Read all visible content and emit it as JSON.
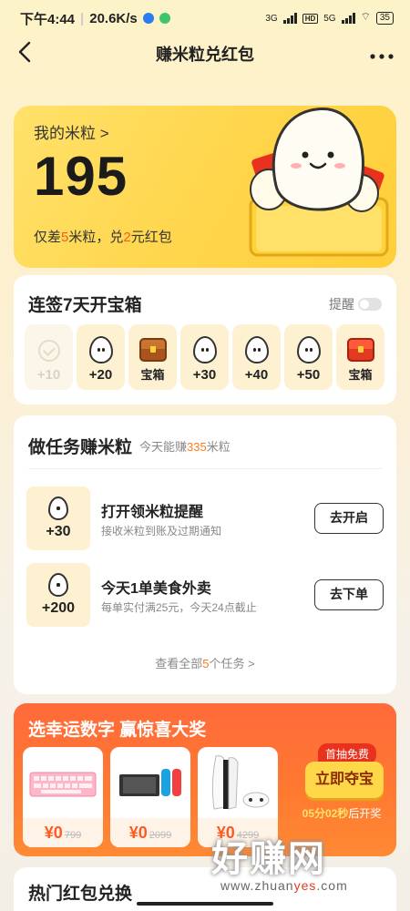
{
  "status_bar": {
    "time": "下午4:44",
    "speed": "20.6K/s",
    "net1": "3G",
    "hd": "HD",
    "net2": "5G",
    "battery": "35"
  },
  "header": {
    "title": "赚米粒兑红包",
    "back_icon": "back-arrow",
    "more_icon": "more-dots"
  },
  "points": {
    "label": "我的米粒 >",
    "value": "195",
    "hint_prefix": "仅差",
    "hint_num1": "5",
    "hint_mid": "米粒，兑",
    "hint_num2": "2",
    "hint_suffix": "元红包"
  },
  "sign": {
    "title": "连签7天开宝箱",
    "remind_label": "提醒",
    "days": [
      {
        "label": "+10",
        "state": "done"
      },
      {
        "label": "+20",
        "state": "rice"
      },
      {
        "label": "宝箱",
        "state": "chest"
      },
      {
        "label": "+30",
        "state": "rice"
      },
      {
        "label": "+40",
        "state": "rice"
      },
      {
        "label": "+50",
        "state": "rice"
      },
      {
        "label": "宝箱",
        "state": "chest-red"
      }
    ]
  },
  "tasks": {
    "title": "做任务赚米粒",
    "sub_prefix": "今天能赚",
    "sub_num": "335",
    "sub_suffix": "米粒",
    "items": [
      {
        "points": "+30",
        "name": "打开领米粒提醒",
        "desc": "接收米粒到账及过期通知",
        "button": "去开启"
      },
      {
        "points": "+200",
        "name": "今天1单美食外卖",
        "desc": "每单实付满25元，今天24点截止",
        "button": "去下单"
      }
    ],
    "view_all_prefix": "查看全部",
    "view_all_num": "5",
    "view_all_suffix": "个任务 >"
  },
  "lucky": {
    "title": "选幸运数字 赢惊喜大奖",
    "prizes": [
      {
        "now": "¥0",
        "old": "799"
      },
      {
        "now": "¥0",
        "old": "2099"
      },
      {
        "now": "¥0",
        "old": "4299"
      }
    ],
    "free_tag": "首抽免费",
    "grab_button": "立即夺宝",
    "countdown_time": "05分02秒",
    "countdown_suffix": "后开奖"
  },
  "hot": {
    "title": "热门红包兑换"
  },
  "watermark": {
    "text": "好赚网",
    "url_prefix": "www.zhuan",
    "url_hl": "yes",
    "url_suffix": ".com"
  }
}
